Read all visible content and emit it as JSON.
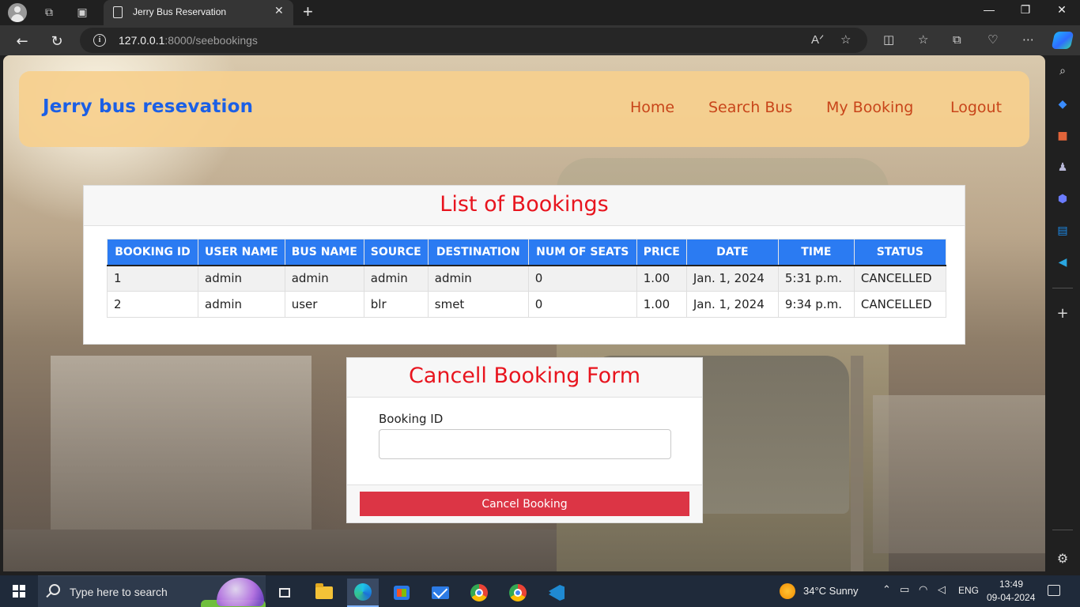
{
  "browser": {
    "tab_title": "Jerry Bus Reservation",
    "tab_close": "✕",
    "new_tab": "+",
    "url_host": "127.0.0.1",
    "url_path": ":8000/seebookings",
    "window_controls": {
      "minimize": "—",
      "maximize": "❐",
      "close": "✕"
    },
    "read_aloud": "Aᐟ",
    "icons": [
      "profile-icon",
      "workspaces-icon",
      "tab-actions-icon",
      "back-icon",
      "refresh-icon",
      "site-info-icon",
      "read-aloud-icon",
      "favorite-star-icon",
      "split-screen-icon",
      "favorites-icon",
      "collections-icon",
      "browser-essentials-icon",
      "more-icon",
      "copilot-icon"
    ]
  },
  "sidebar": {
    "icons": [
      "search-icon",
      "shopping-tag-icon",
      "tools-icon",
      "games-icon",
      "microsoft365-icon",
      "outlook-icon",
      "telegram-icon",
      "add-icon",
      "settings-icon"
    ],
    "add": "+",
    "settings": "⚙"
  },
  "site": {
    "brand": "Jerry bus resevation",
    "nav": {
      "home": "Home",
      "search": "Search Bus",
      "my_booking": "My Booking",
      "logout": "Logout"
    },
    "colors": {
      "header_bg": "#f6d08e",
      "brand": "#1b5fe6",
      "nav": "#c8451a",
      "accent_red": "#e8141e",
      "table_head": "#2b7bf2",
      "button": "#dc3545"
    }
  },
  "bookings": {
    "title": "List of Bookings",
    "columns": [
      "BOOKING ID",
      "USER NAME",
      "BUS NAME",
      "SOURCE",
      "DESTINATION",
      "NUM OF SEATS",
      "PRICE",
      "DATE",
      "TIME",
      "STATUS"
    ],
    "rows": [
      [
        "1",
        "admin",
        "admin",
        "admin",
        "admin",
        "0",
        "1.00",
        "Jan. 1, 2024",
        "5:31 p.m.",
        "CANCELLED"
      ],
      [
        "2",
        "admin",
        "user",
        "blr",
        "smet",
        "0",
        "1.00",
        "Jan. 1, 2024",
        "9:34 p.m.",
        "CANCELLED"
      ]
    ]
  },
  "cancel_form": {
    "title": "Cancell Booking Form",
    "label": "Booking ID",
    "value": "",
    "button": "Cancel Booking"
  },
  "taskbar": {
    "search_placeholder": "Type here to search",
    "weather": "34°C  Sunny",
    "language": "ENG",
    "time": "13:49",
    "date": "09-04-2024",
    "apps": [
      "task-view-icon",
      "file-explorer-icon",
      "edge-icon",
      "microsoft-store-icon",
      "mail-icon",
      "chrome-icon",
      "chrome-profile-icon",
      "vscode-icon"
    ]
  }
}
